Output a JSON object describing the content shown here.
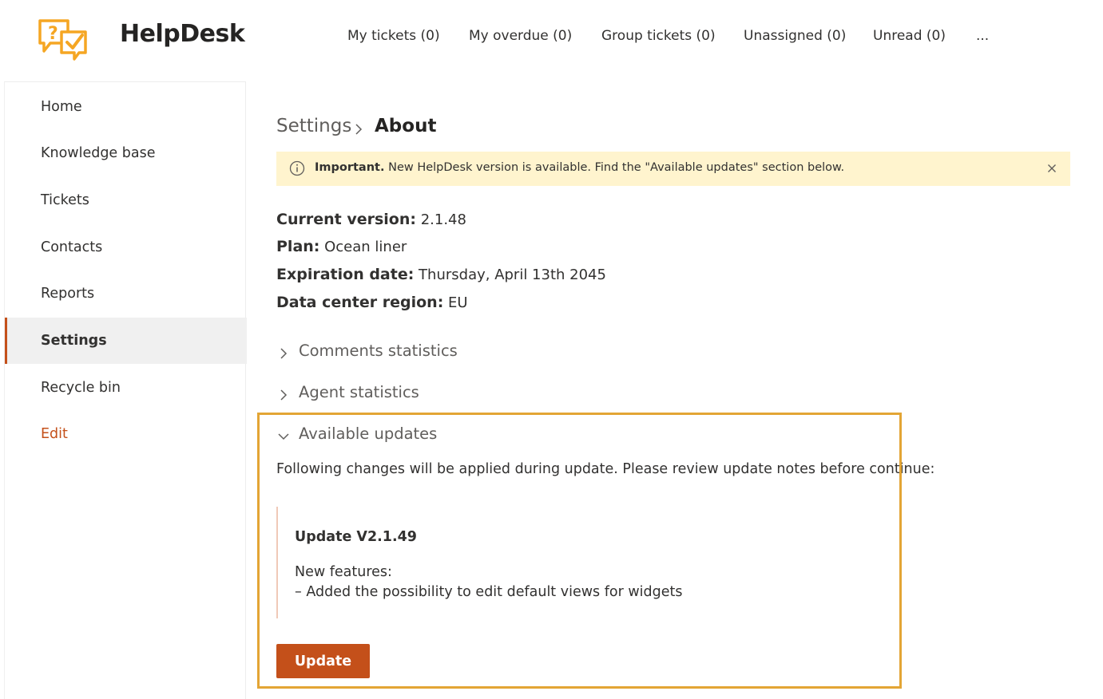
{
  "app": {
    "title": "HelpDesk",
    "logo_icon": "helpdesk-chat-question-check-logo"
  },
  "topnav": {
    "items": [
      {
        "label": "My tickets (0)"
      },
      {
        "label": "My overdue (0)"
      },
      {
        "label": "Group tickets (0)"
      },
      {
        "label": "Unassigned (0)"
      },
      {
        "label": "Unread (0)"
      },
      {
        "label": "..."
      }
    ]
  },
  "sidebar": {
    "items": [
      {
        "label": "Home",
        "active": false
      },
      {
        "label": "Knowledge base",
        "active": false
      },
      {
        "label": "Tickets",
        "active": false
      },
      {
        "label": "Contacts",
        "active": false
      },
      {
        "label": "Reports",
        "active": false
      },
      {
        "label": "Settings",
        "active": true
      },
      {
        "label": "Recycle bin",
        "active": false
      }
    ],
    "edit_label": "Edit"
  },
  "breadcrumb": {
    "parent": "Settings",
    "current": "About"
  },
  "banner": {
    "strong": "Important.",
    "text": " New HelpDesk version is available. Find the \"Available updates\" section below.",
    "icon": "info-icon",
    "close_icon": "close-icon"
  },
  "about": {
    "current_version": {
      "label": "Current version:",
      "value": " 2.1.48"
    },
    "plan": {
      "label": "Plan:",
      "value": " Ocean liner"
    },
    "expiration": {
      "label": "Expiration date:",
      "value": " Thursday, April 13th 2045"
    },
    "region": {
      "label": "Data center region:",
      "value": " EU"
    }
  },
  "sections": {
    "comments": {
      "label": "Comments statistics",
      "expanded": false
    },
    "agents": {
      "label": "Agent statistics",
      "expanded": false
    },
    "updates": {
      "label": "Available updates",
      "expanded": true
    }
  },
  "updates": {
    "intro": "Following changes will be applied during update. Please review update notes before continue:",
    "version_title": "Update V2.1.49",
    "features_heading": "New features:",
    "feature_1": "– Added the possibility to edit default views for widgets",
    "button_label": "Update"
  },
  "colors": {
    "accent": "#c4501a",
    "banner_bg": "#fff4ce",
    "highlight_border": "#e3a535",
    "logo": "#f5a623"
  }
}
